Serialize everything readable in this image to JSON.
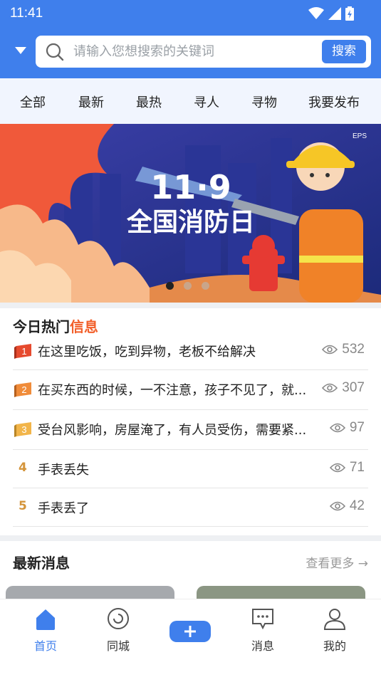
{
  "status": {
    "time": "11:41"
  },
  "search": {
    "placeholder": "请输入您想搜索的关键词",
    "button": "搜索"
  },
  "tabs": [
    "全部",
    "最新",
    "最热",
    "寻人",
    "寻物",
    "我要发布"
  ],
  "banner": {
    "title_line1": "11·9",
    "title_line2": "全国消防日",
    "tag": "EPS",
    "slide_count": 3,
    "active_slide": 1
  },
  "hot": {
    "title_prefix": "今日热门",
    "title_accent": "信息",
    "items": [
      {
        "rank": "1",
        "text": "在这里吃饭，吃到异物，老板不给解决",
        "views": "532"
      },
      {
        "rank": "2",
        "text": "在买东西的时候，一不注意，孩子不见了，就...",
        "views": "307"
      },
      {
        "rank": "3",
        "text": "受台风影响，房屋淹了，有人员受伤，需要紧...",
        "views": "97"
      },
      {
        "rank": "4",
        "text": "手表丢失",
        "views": "71"
      },
      {
        "rank": "5",
        "text": "手表丢了",
        "views": "42"
      }
    ]
  },
  "latest": {
    "title": "最新消息",
    "more": "查看更多 →"
  },
  "tabbar": {
    "home": "首页",
    "city": "同城",
    "messages": "消息",
    "mine": "我的"
  },
  "colors": {
    "primary": "#3f7fec",
    "accent": "#f2602b",
    "rank_gold": "#d4943a"
  }
}
